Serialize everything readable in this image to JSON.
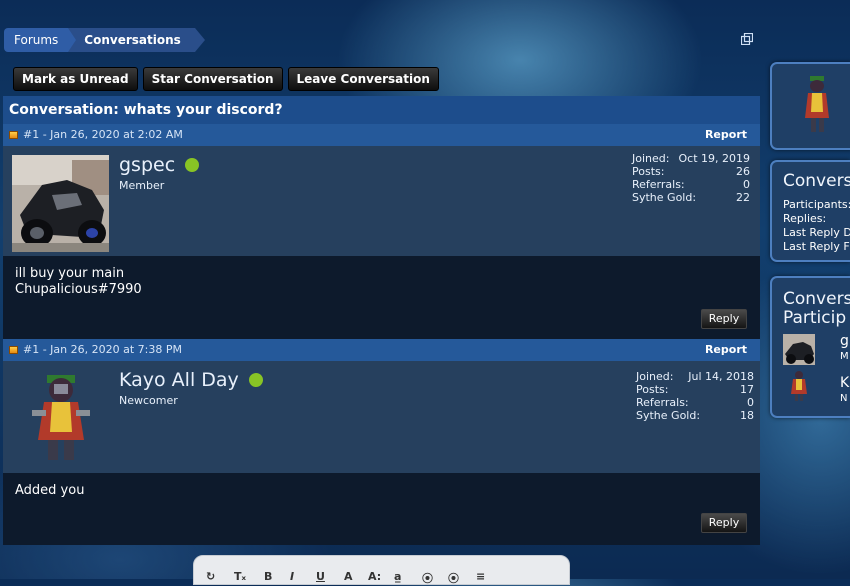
{
  "breadcrumb": {
    "home": "Forums",
    "current": "Conversations"
  },
  "actions": {
    "mark_unread": "Mark as Unread",
    "star": "Star Conversation",
    "leave": "Leave Conversation"
  },
  "conversation": {
    "title": "Conversation: whats your discord?"
  },
  "labels": {
    "joined": "Joined:",
    "posts": "Posts:",
    "referrals": "Referrals:",
    "gold": "Sythe Gold:",
    "report": "Report",
    "reply": "Reply"
  },
  "posts": [
    {
      "header": "#1 - Jan 26, 2020 at 2:02 AM",
      "username": "gspec",
      "role": "Member",
      "joined": "Oct 19, 2019",
      "posts": "26",
      "referrals": "0",
      "gold": "22",
      "message_lines": [
        "ill buy your main",
        "Chupalicious#7990"
      ]
    },
    {
      "header": "#1 - Jan 26, 2020 at 7:38 PM",
      "username": "Kayo All Day",
      "role": "Newcomer",
      "joined": "Jul 14, 2018",
      "posts": "17",
      "referrals": "0",
      "gold": "18",
      "message_lines": [
        "Added you"
      ]
    }
  ],
  "sidebar": {
    "info_title": "Convers",
    "info_rows": [
      "Participants:",
      "Replies:",
      "Last Reply D",
      "Last Reply F"
    ],
    "participants_title_1": "Convers",
    "participants_title_2": "Particip",
    "participants": [
      {
        "name": "g",
        "role": "M"
      },
      {
        "name": "K",
        "role": "N"
      }
    ]
  },
  "editor": {
    "tools": [
      "↻",
      "Tₓ",
      "B",
      "I",
      "U",
      "A",
      "A:",
      "a̲",
      "⦿",
      "⦿",
      "≡"
    ]
  },
  "colors": {
    "online": "#88c425",
    "title_bar": "#1d4d8c",
    "post_header": "#25599a",
    "user_block": "#26405e"
  }
}
